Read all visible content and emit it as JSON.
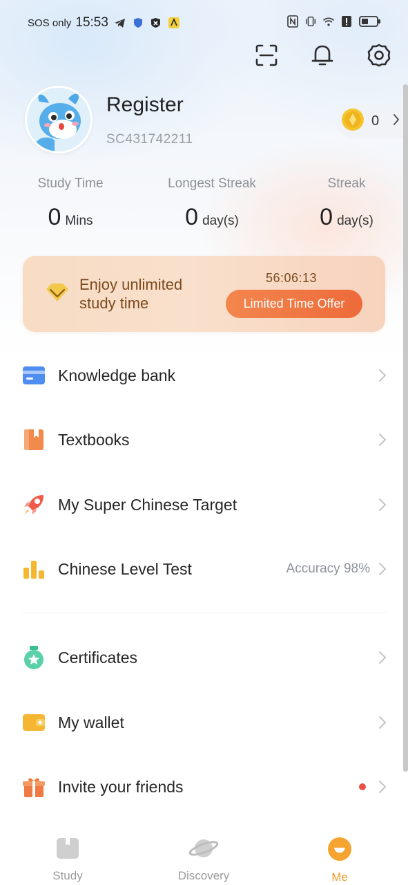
{
  "status_bar": {
    "carrier": "SOS only",
    "time": "15:53"
  },
  "header": {
    "icons": [
      "scan-icon",
      "bell-icon",
      "gear-icon"
    ]
  },
  "profile": {
    "username": "Register",
    "user_id": "SC431742211",
    "coins": "0"
  },
  "stats": [
    {
      "label": "Study Time",
      "value": "0",
      "unit": "Mins"
    },
    {
      "label": "Longest Streak",
      "value": "0",
      "unit": "day(s)"
    },
    {
      "label": "Streak",
      "value": "0",
      "unit": "day(s)"
    }
  ],
  "promo": {
    "text": "Enjoy unlimited study time",
    "timer": "56:06:13",
    "button": "Limited Time Offer"
  },
  "menu": {
    "group1": [
      {
        "label": "Knowledge bank",
        "extra": ""
      },
      {
        "label": "Textbooks",
        "extra": ""
      },
      {
        "label": "My Super Chinese Target",
        "extra": ""
      },
      {
        "label": "Chinese Level Test",
        "extra": "Accuracy 98%"
      }
    ],
    "group2": [
      {
        "label": "Certificates",
        "extra": ""
      },
      {
        "label": "My wallet",
        "extra": ""
      },
      {
        "label": "Invite your friends",
        "extra": ""
      }
    ]
  },
  "bottom_nav": [
    {
      "label": "Study",
      "active": false
    },
    {
      "label": "Discovery",
      "active": false
    },
    {
      "label": "Me",
      "active": true
    }
  ],
  "colors": {
    "accent": "#f2992a",
    "promo_button": "#ee6a3a",
    "notification_dot": "#ea4f45"
  }
}
